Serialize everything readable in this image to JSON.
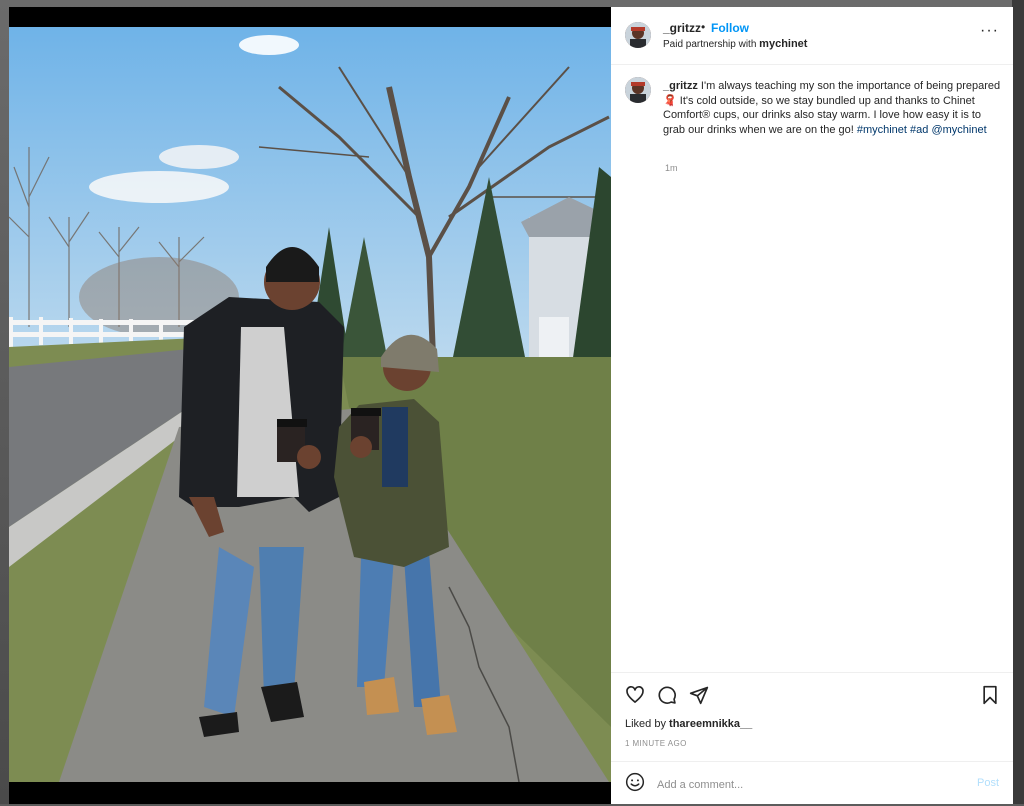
{
  "post": {
    "username": "_gritzz",
    "separator": "•",
    "follow_label": "Follow",
    "partnership_prefix": "Paid partnership with",
    "partner": "mychinet",
    "more_label": "···"
  },
  "caption": {
    "username": "_gritzz",
    "text_1": "I'm always teaching my son the importance of being prepared",
    "emoji": "🧣",
    "text_2": "It's cold outside, so we stay bundled up and thanks to Chinet Comfort® cups, our drinks also stay warm. I love how easy it is to grab our drinks when we are on the go!",
    "hashtag_1": "#mychinet",
    "hashtag_2": "#ad",
    "mention": "@mychinet",
    "time": "1m"
  },
  "actions": {
    "like_icon": "heart-icon",
    "comment_icon": "comment-icon",
    "share_icon": "share-icon",
    "save_icon": "bookmark-icon"
  },
  "likes": {
    "prefix": "Liked by",
    "user": "thareemnikka__"
  },
  "timestamp": "1 MINUTE AGO",
  "comment": {
    "placeholder": "Add a comment...",
    "post_label": "Post",
    "emoji_icon": "smiley-icon"
  },
  "colors": {
    "link": "#0095f6",
    "hashtag": "#00376b",
    "post_disabled": "#b2dffc"
  }
}
